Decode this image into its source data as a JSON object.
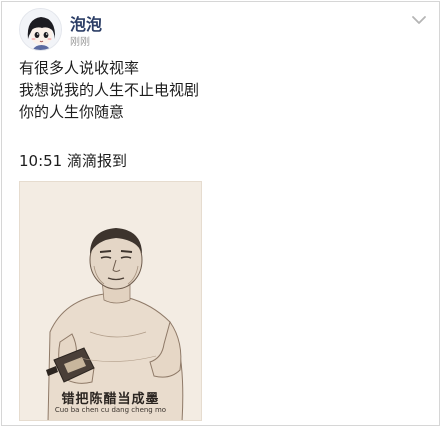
{
  "post": {
    "author_name": "泡泡",
    "timestamp": "刚刚",
    "text_lines": [
      "有很多人说收视率",
      "我想说我的人生不止电视剧",
      "你的人生你随意"
    ],
    "checkin": "10:51 滴滴报到"
  },
  "poster": {
    "title": "错把陈醋当成墨",
    "pinyin": "Cuo ba chen cu dang cheng mo"
  },
  "icons": {
    "avatar": "anime-girl-avatar",
    "menu": "chevron-down-icon"
  }
}
